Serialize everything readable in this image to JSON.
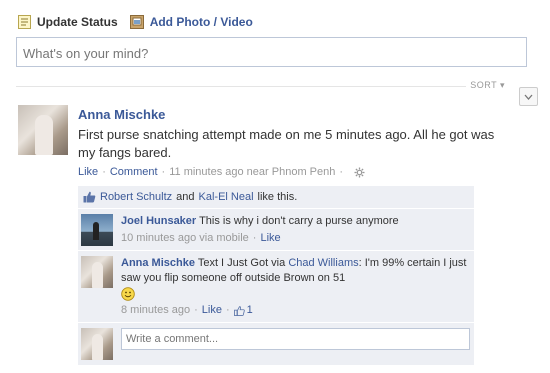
{
  "composer": {
    "update_status_label": "Update Status",
    "add_photo_label": "Add Photo / Video",
    "status_placeholder": "What's on your mind?"
  },
  "feed": {
    "sort_label": "SORT"
  },
  "post": {
    "author": "Anna Mischke",
    "message": "First purse snatching attempt made on me 5 minutes ago. All he got was my fangs bared.",
    "like_label": "Like",
    "comment_label": "Comment",
    "timestamp": "11 minutes ago near Phnom Penh",
    "likes": {
      "user1": "Robert Schultz",
      "and": "and",
      "user2": "Kal-El Neal",
      "suffix": "like this."
    },
    "comments": [
      {
        "author": "Joel Hunsaker",
        "text": "This is why i don't carry a purse anymore",
        "time": "10 minutes ago via mobile",
        "like_label": "Like"
      },
      {
        "author": "Anna Mischke",
        "text_prefix": "Text I Just Got via",
        "mention": "Chad Williams",
        "text_suffix": ": I'm 99% certain I just saw you flip someone off outside Brown on 51",
        "time": "8 minutes ago",
        "like_label": "Like",
        "like_count": "1"
      }
    ],
    "write_comment_placeholder": "Write a comment..."
  },
  "colors": {
    "link": "#3b5998",
    "feedback_bg": "#edeff4",
    "muted": "#999999"
  }
}
